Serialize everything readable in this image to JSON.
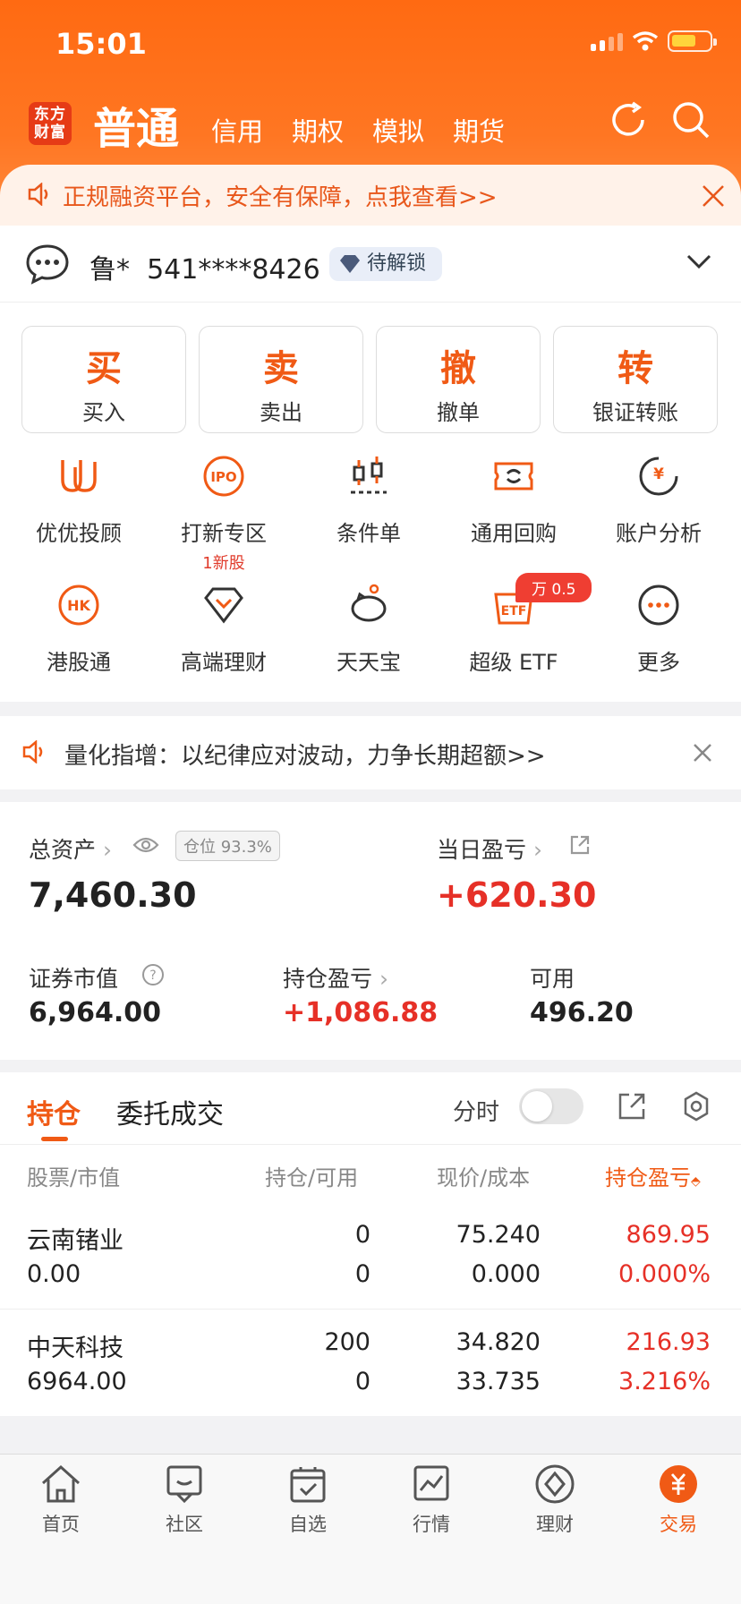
{
  "status": {
    "time": "15:01"
  },
  "header": {
    "logo_line1": "东方",
    "logo_line2": "财富",
    "active_tab": "普通",
    "tabs": [
      "信用",
      "期权",
      "模拟",
      "期货"
    ]
  },
  "notice_top": {
    "text": "正规融资平台，安全有保障，点我查看>>"
  },
  "account": {
    "name": "鲁*",
    "number": "541****8426",
    "badge": "待解锁"
  },
  "trade_buttons": [
    {
      "big": "买",
      "label": "买入"
    },
    {
      "big": "卖",
      "label": "卖出"
    },
    {
      "big": "撤",
      "label": "撤单"
    },
    {
      "big": "转",
      "label": "银证转账"
    }
  ],
  "grid": [
    {
      "label": "优优投顾",
      "icon": "uu-advisor-icon"
    },
    {
      "label": "打新专区",
      "sub": "1新股",
      "icon": "ipo-icon"
    },
    {
      "label": "条件单",
      "icon": "condition-order-icon"
    },
    {
      "label": "通用回购",
      "icon": "repo-icon"
    },
    {
      "label": "账户分析",
      "icon": "account-analysis-icon"
    },
    {
      "label": "港股通",
      "icon": "hk-icon"
    },
    {
      "label": "高端理财",
      "icon": "wealth-icon"
    },
    {
      "label": "天天宝",
      "icon": "piggy-icon"
    },
    {
      "label": "超级 ETF",
      "icon": "etf-icon",
      "badge": "万 0.5"
    },
    {
      "label": "更多",
      "icon": "more-icon"
    }
  ],
  "notice_mid": {
    "text": "量化指增：以纪律应对波动，力争长期超额>>"
  },
  "assets": {
    "total_label": "总资产",
    "position_badge": "仓位 93.3%",
    "total_value": "7,460.30",
    "daily_pl_label": "当日盈亏",
    "daily_pl_value": "+620.30",
    "market_value_label": "证券市值",
    "market_value": "6,964.00",
    "hold_pl_label": "持仓盈亏",
    "hold_pl_value": "+1,086.88",
    "available_label": "可用",
    "available_value": "496.20"
  },
  "holdings": {
    "tab_active": "持仓",
    "tab_other": "委托成交",
    "timeshare_label": "分时",
    "col_stock": "股票/市值",
    "col_position": "持仓/可用",
    "col_price": "现价/成本",
    "col_pl": "持仓盈亏",
    "rows": [
      {
        "name": "云南锗业",
        "mv": "0.00",
        "pos": "0",
        "avail": "0",
        "price": "75.240",
        "cost": "0.000",
        "pl": "869.95",
        "pl_pct": "0.000%"
      },
      {
        "name": "中天科技",
        "mv": "6964.00",
        "pos": "200",
        "avail": "0",
        "price": "34.820",
        "cost": "33.735",
        "pl": "216.93",
        "pl_pct": "3.216%"
      }
    ]
  },
  "tabbar": [
    {
      "label": "首页",
      "icon": "home-icon"
    },
    {
      "label": "社区",
      "icon": "community-icon"
    },
    {
      "label": "自选",
      "icon": "watchlist-icon"
    },
    {
      "label": "行情",
      "icon": "market-icon"
    },
    {
      "label": "理财",
      "icon": "finance-icon"
    },
    {
      "label": "交易",
      "icon": "trade-icon",
      "active": true
    }
  ],
  "colors": {
    "brand": "#ff6a12",
    "accent": "#f05a15",
    "up": "#e63027"
  }
}
